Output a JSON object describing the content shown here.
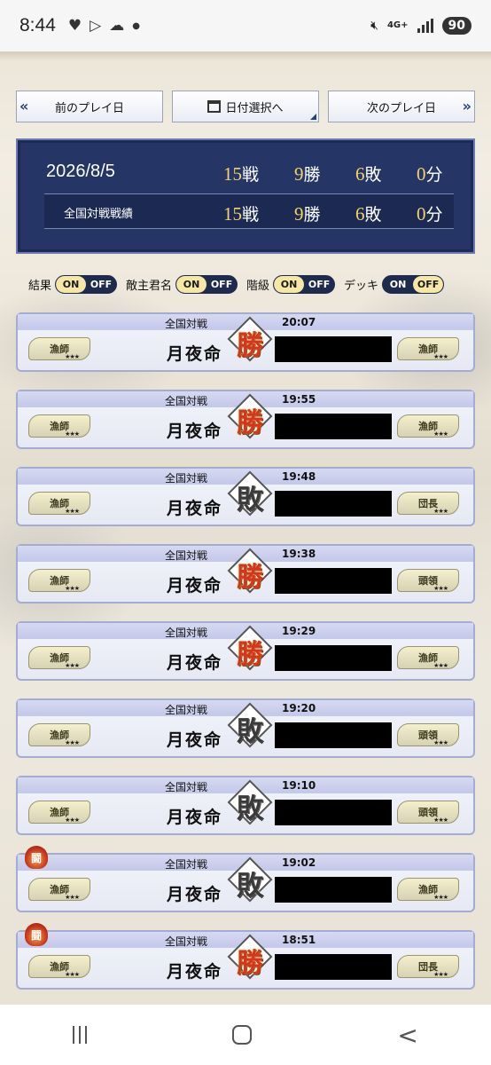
{
  "statusbar": {
    "time": "8:44",
    "network": "4G+",
    "battery": "90",
    "icons": [
      "heart-icon",
      "play-store-icon",
      "cloud-icon",
      "dot-icon",
      "mute-icon",
      "signal-icon"
    ]
  },
  "nav": {
    "prev_label": "前のプレイ日",
    "date_label": "日付選択へ",
    "next_label": "次のプレイ日"
  },
  "summary": {
    "date": "2026/8/5",
    "day": {
      "battles": "15",
      "battles_unit": "戦",
      "wins": "9",
      "wins_unit": "勝",
      "losses": "6",
      "losses_unit": "敗",
      "draws": "0",
      "draws_unit": "分"
    },
    "overall_label": "全国対戦戦績",
    "overall": {
      "battles": "15",
      "battles_unit": "戦",
      "wins": "9",
      "wins_unit": "勝",
      "losses": "6",
      "losses_unit": "敗",
      "draws": "0",
      "draws_unit": "分"
    }
  },
  "filters": [
    {
      "label": "結果",
      "on": "ON",
      "off": "OFF",
      "active": "on"
    },
    {
      "label": "敵主君名",
      "on": "ON",
      "off": "OFF",
      "active": "on"
    },
    {
      "label": "階級",
      "on": "ON",
      "off": "OFF",
      "active": "on"
    },
    {
      "label": "デッキ",
      "on": "ON",
      "off": "OFF",
      "active": "off"
    }
  ],
  "battles": [
    {
      "mode": "全国対戦",
      "time": "20:07",
      "name": "月夜命",
      "result": "勝",
      "flame": false,
      "left_rank": "漁師",
      "right_rank": "漁師"
    },
    {
      "mode": "全国対戦",
      "time": "19:55",
      "name": "月夜命",
      "result": "勝",
      "flame": false,
      "left_rank": "漁師",
      "right_rank": "漁師"
    },
    {
      "mode": "全国対戦",
      "time": "19:48",
      "name": "月夜命",
      "result": "敗",
      "flame": false,
      "left_rank": "漁師",
      "right_rank": "団長"
    },
    {
      "mode": "全国対戦",
      "time": "19:38",
      "name": "月夜命",
      "result": "勝",
      "flame": false,
      "left_rank": "漁師",
      "right_rank": "頭領"
    },
    {
      "mode": "全国対戦",
      "time": "19:29",
      "name": "月夜命",
      "result": "勝",
      "flame": false,
      "left_rank": "漁師",
      "right_rank": "漁師"
    },
    {
      "mode": "全国対戦",
      "time": "19:20",
      "name": "月夜命",
      "result": "敗",
      "flame": false,
      "left_rank": "漁師",
      "right_rank": "頭領"
    },
    {
      "mode": "全国対戦",
      "time": "19:10",
      "name": "月夜命",
      "result": "敗",
      "flame": false,
      "left_rank": "漁師",
      "right_rank": "頭領"
    },
    {
      "mode": "全国対戦",
      "time": "19:02",
      "name": "月夜命",
      "result": "敗",
      "flame": true,
      "flame_text": "闘",
      "left_rank": "漁師",
      "right_rank": "漁師"
    },
    {
      "mode": "全国対戦",
      "time": "18:51",
      "name": "月夜命",
      "result": "勝",
      "flame": true,
      "flame_text": "闘",
      "left_rank": "漁師",
      "right_rank": "団長"
    }
  ],
  "navbar": {
    "icons": [
      "recent-apps-icon",
      "home-icon",
      "back-icon"
    ]
  }
}
